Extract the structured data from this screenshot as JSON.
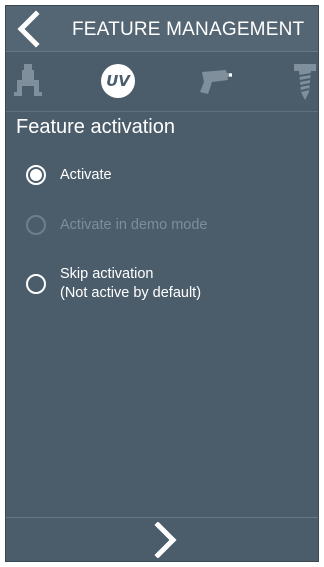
{
  "header": {
    "title": "FEATURE MANAGEMENT",
    "back_icon": "chevron-left-icon"
  },
  "tabs": [
    {
      "icon": "gripper-icon",
      "active": false
    },
    {
      "icon": "uv-icon",
      "label": "UV",
      "active": true
    },
    {
      "icon": "scanner-gun-icon",
      "active": false
    },
    {
      "icon": "screw-icon",
      "active": false
    }
  ],
  "main": {
    "section_title": "Feature activation",
    "options": [
      {
        "label": "Activate",
        "selected": true,
        "disabled": false
      },
      {
        "label": "Activate in demo mode",
        "selected": false,
        "disabled": true
      },
      {
        "label_line1": "Skip activation",
        "label_line2": "(Not active by default)",
        "selected": false,
        "disabled": false
      }
    ]
  },
  "footer": {
    "next_icon": "chevron-right-icon"
  },
  "colors": {
    "background": "#4b5d6b",
    "header": "#546673",
    "text": "#ffffff",
    "disabled_text": "#7d8e9b",
    "inactive_icon": "#7f909c"
  }
}
